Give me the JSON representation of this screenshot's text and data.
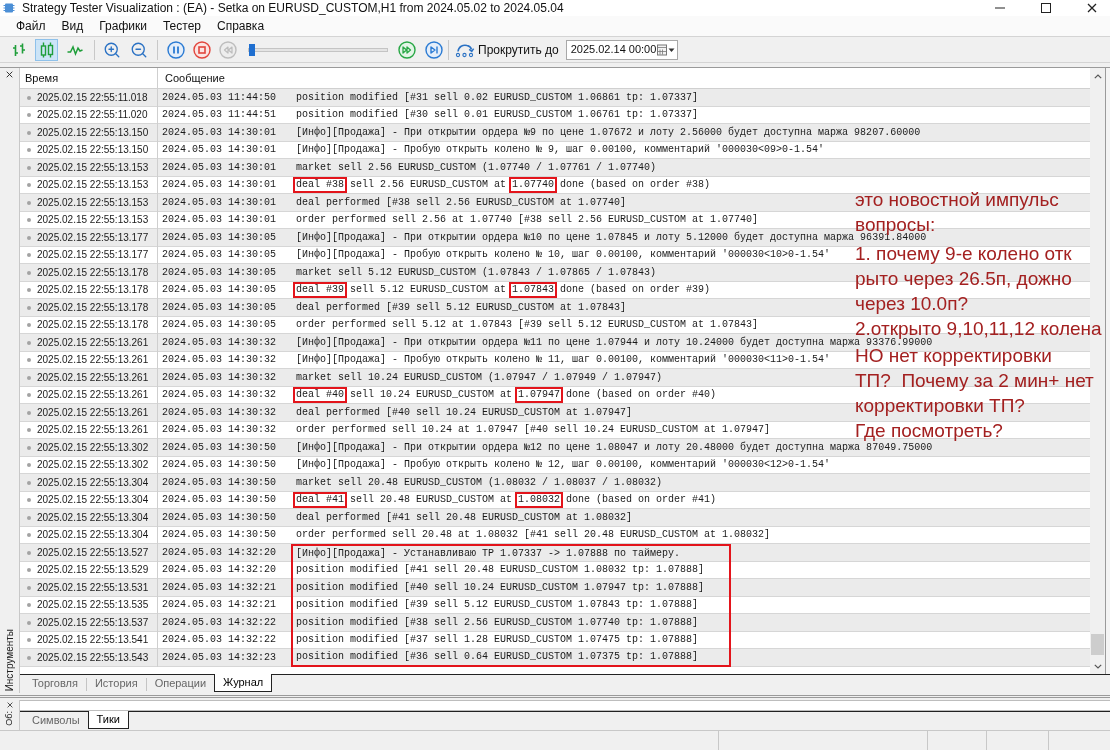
{
  "window": {
    "title": "Strategy Tester Visualization : (EA) - Setka on EURUSD_CUSTOM,H1 from 2024.05.02 to 2024.05.04"
  },
  "menu": [
    "Файл",
    "Вид",
    "Графики",
    "Тестер",
    "Справка"
  ],
  "toolbar": {
    "chart_modes": [
      {
        "kind": "bars",
        "selected": false
      },
      {
        "kind": "candles",
        "selected": true
      },
      {
        "kind": "line",
        "selected": false
      }
    ],
    "zoom": [
      {
        "kind": "zoom_in"
      },
      {
        "kind": "zoom_out"
      }
    ],
    "playback": [
      {
        "kind": "pause",
        "disabled": false
      },
      {
        "kind": "stop",
        "disabled": false
      },
      {
        "kind": "rewind",
        "disabled": true
      }
    ],
    "speed": {
      "level": 0.0
    },
    "stepping": [
      {
        "kind": "fast_forward"
      },
      {
        "kind": "step"
      }
    ],
    "scroll_to": {
      "label": "Прокрутить до",
      "value": "2025.02.14 00:00"
    }
  },
  "journal": {
    "columns": [
      "Время",
      "Сообщение"
    ],
    "rows": [
      {
        "time": "2025.02.15 22:55:11.018",
        "date": "2024.05.03 11:44:50",
        "message": "position modified [#31 sell 0.02 EURUSD_CUSTOM 1.06861 tp: 1.07337]",
        "framed": false
      },
      {
        "time": "2025.02.15 22:55:11.020",
        "date": "2024.05.03 11:44:51",
        "message": "position modified [#30 sell 0.01 EURUSD_CUSTOM 1.06761 tp: 1.07337]",
        "framed": false
      },
      {
        "time": "2025.02.15 22:55:13.150",
        "date": "2024.05.03 14:30:01",
        "message": "[Инфо][Продажа] - При открытии ордера №9 по цене 1.07672 и лоту 2.56000 будет доступна маржа 98207.60000",
        "framed": false
      },
      {
        "time": "2025.02.15 22:55:13.150",
        "date": "2024.05.03 14:30:01",
        "message": "[Инфо][Продажа] - Пробую открыть колено № 9, шаг 0.00100, комментарий '000030<09>0-1.54'",
        "framed": false
      },
      {
        "time": "2025.02.15 22:55:13.153",
        "date": "2024.05.03 14:30:01",
        "message": "market sell 2.56 EURUSD_CUSTOM (1.07740 / 1.07761 / 1.07740)",
        "framed": false
      },
      {
        "time": "2025.02.15 22:55:13.153",
        "date": "2024.05.03 14:30:01",
        "parts": [
          {
            "text": "deal #38",
            "marked": true
          },
          {
            "text": " sell 2.56 EURUSD_CUSTOM at ",
            "marked": false
          },
          {
            "text": "1.07740",
            "marked": true
          },
          {
            "text": " done (based on order #38)",
            "marked": false
          }
        ],
        "framed": false
      },
      {
        "time": "2025.02.15 22:55:13.153",
        "date": "2024.05.03 14:30:01",
        "message": "deal performed [#38 sell 2.56 EURUSD_CUSTOM at 1.07740]",
        "framed": false
      },
      {
        "time": "2025.02.15 22:55:13.153",
        "date": "2024.05.03 14:30:01",
        "message": "order performed sell 2.56 at 1.07740 [#38 sell 2.56 EURUSD_CUSTOM at 1.07740]",
        "framed": false
      },
      {
        "time": "2025.02.15 22:55:13.177",
        "date": "2024.05.03 14:30:05",
        "message": "[Инфо][Продажа] - При открытии ордера №10 по цене 1.07845 и лоту 5.12000 будет доступна маржа 96391.84000",
        "framed": false
      },
      {
        "time": "2025.02.15 22:55:13.177",
        "date": "2024.05.03 14:30:05",
        "message": "[Инфо][Продажа] - Пробую открыть колено № 10, шаг 0.00100, комментарий '000030<10>0-1.54'",
        "framed": false
      },
      {
        "time": "2025.02.15 22:55:13.178",
        "date": "2024.05.03 14:30:05",
        "message": "market sell 5.12 EURUSD_CUSTOM (1.07843 / 1.07865 / 1.07843)",
        "framed": false
      },
      {
        "time": "2025.02.15 22:55:13.178",
        "date": "2024.05.03 14:30:05",
        "parts": [
          {
            "text": "deal #39",
            "marked": true
          },
          {
            "text": " sell 5.12 EURUSD_CUSTOM at ",
            "marked": false
          },
          {
            "text": "1.07843",
            "marked": true
          },
          {
            "text": " done (based on order #39)",
            "marked": false
          }
        ],
        "framed": false
      },
      {
        "time": "2025.02.15 22:55:13.178",
        "date": "2024.05.03 14:30:05",
        "message": "deal performed [#39 sell 5.12 EURUSD_CUSTOM at 1.07843]",
        "framed": false
      },
      {
        "time": "2025.02.15 22:55:13.178",
        "date": "2024.05.03 14:30:05",
        "message": "order performed sell 5.12 at 1.07843 [#39 sell 5.12 EURUSD_CUSTOM at 1.07843]",
        "framed": false
      },
      {
        "time": "2025.02.15 22:55:13.261",
        "date": "2024.05.03 14:30:32",
        "message": "[Инфо][Продажа] - При открытии ордера №11 по цене 1.07944 и лоту 10.24000 будет доступна маржа 93376.99000",
        "framed": false
      },
      {
        "time": "2025.02.15 22:55:13.261",
        "date": "2024.05.03 14:30:32",
        "message": "[Инфо][Продажа] - Пробую открыть колено № 11, шаг 0.00100, комментарий '000030<11>0-1.54'",
        "framed": false
      },
      {
        "time": "2025.02.15 22:55:13.261",
        "date": "2024.05.03 14:30:32",
        "message": "market sell 10.24 EURUSD_CUSTOM (1.07947 / 1.07949 / 1.07947)",
        "framed": false
      },
      {
        "time": "2025.02.15 22:55:13.261",
        "date": "2024.05.03 14:30:32",
        "parts": [
          {
            "text": "deal #40",
            "marked": true
          },
          {
            "text": " sell 10.24 EURUSD_CUSTOM at ",
            "marked": false
          },
          {
            "text": "1.07947",
            "marked": true
          },
          {
            "text": " done (based on order #40)",
            "marked": false
          }
        ],
        "framed": false
      },
      {
        "time": "2025.02.15 22:55:13.261",
        "date": "2024.05.03 14:30:32",
        "message": "deal performed [#40 sell 10.24 EURUSD_CUSTOM at 1.07947]",
        "framed": false
      },
      {
        "time": "2025.02.15 22:55:13.261",
        "date": "2024.05.03 14:30:32",
        "message": "order performed sell 10.24 at 1.07947 [#40 sell 10.24 EURUSD_CUSTOM at 1.07947]",
        "framed": false
      },
      {
        "time": "2025.02.15 22:55:13.302",
        "date": "2024.05.03 14:30:50",
        "message": "[Инфо][Продажа] - При открытии ордера №12 по цене 1.08047 и лоту 20.48000 будет доступна маржа 87049.75000",
        "framed": false
      },
      {
        "time": "2025.02.15 22:55:13.302",
        "date": "2024.05.03 14:30:50",
        "message": "[Инфо][Продажа] - Пробую открыть колено № 12, шаг 0.00100, комментарий '000030<12>0-1.54'",
        "framed": false
      },
      {
        "time": "2025.02.15 22:55:13.304",
        "date": "2024.05.03 14:30:50",
        "message": "market sell 20.48 EURUSD_CUSTOM (1.08032 / 1.08037 / 1.08032)",
        "framed": false
      },
      {
        "time": "2025.02.15 22:55:13.304",
        "date": "2024.05.03 14:30:50",
        "parts": [
          {
            "text": "deal #41",
            "marked": true
          },
          {
            "text": " sell 20.48 EURUSD_CUSTOM at ",
            "marked": false
          },
          {
            "text": "1.08032",
            "marked": true
          },
          {
            "text": " done (based on order #41)",
            "marked": false
          }
        ],
        "framed": false
      },
      {
        "time": "2025.02.15 22:55:13.304",
        "date": "2024.05.03 14:30:50",
        "message": "deal performed [#41 sell 20.48 EURUSD_CUSTOM at 1.08032]",
        "framed": false
      },
      {
        "time": "2025.02.15 22:55:13.304",
        "date": "2024.05.03 14:30:50",
        "message": "order performed sell 20.48 at 1.08032 [#41 sell 20.48 EURUSD_CUSTOM at 1.08032]",
        "framed": false
      },
      {
        "time": "2025.02.15 22:55:13.527",
        "date": "2024.05.03 14:32:20",
        "message": "[Инфо][Продажа] - Устанавливаю TP 1.07337 -> 1.07888 по таймеру.",
        "framed": true
      },
      {
        "time": "2025.02.15 22:55:13.529",
        "date": "2024.05.03 14:32:20",
        "message": "position modified [#41 sell 20.48 EURUSD_CUSTOM 1.08032 tp: 1.07888]",
        "framed": true
      },
      {
        "time": "2025.02.15 22:55:13.531",
        "date": "2024.05.03 14:32:21",
        "message": "position modified [#40 sell 10.24 EURUSD_CUSTOM 1.07947 tp: 1.07888]",
        "framed": true
      },
      {
        "time": "2025.02.15 22:55:13.535",
        "date": "2024.05.03 14:32:21",
        "message": "position modified [#39 sell 5.12 EURUSD_CUSTOM 1.07843 tp: 1.07888]",
        "framed": true
      },
      {
        "time": "2025.02.15 22:55:13.537",
        "date": "2024.05.03 14:32:22",
        "message": "position modified [#38 sell 2.56 EURUSD_CUSTOM 1.07740 tp: 1.07888]",
        "framed": true
      },
      {
        "time": "2025.02.15 22:55:13.541",
        "date": "2024.05.03 14:32:22",
        "message": "position modified [#37 sell 1.28 EURUSD_CUSTOM 1.07475 tp: 1.07888]",
        "framed": true
      },
      {
        "time": "2025.02.15 22:55:13.543",
        "date": "2024.05.03 14:32:23",
        "message": "position modified [#36 sell 0.64 EURUSD_CUSTOM 1.07375 tp: 1.07888]",
        "framed": true
      }
    ]
  },
  "annotation": {
    "lines": [
      "это новостной импульс",
      "вопросы:",
      "1. почему 9-е колено отк",
      "рыто через 26.5п, дожно",
      "через 10.0п?",
      "2.открыто 9,10,11,12 колена",
      "НО нет корректировки",
      "ТП?  Почему за 2 мин+ нет",
      "корректировки ТП?",
      "Где посмотреть?"
    ]
  },
  "tools_panel": {
    "side_label": "Инструменты",
    "tabs": [
      {
        "label": "Торговля",
        "selected": false
      },
      {
        "label": "История",
        "selected": false
      },
      {
        "label": "Операции",
        "selected": false
      },
      {
        "label": "Журнал",
        "selected": true
      }
    ]
  },
  "bottom_panel": {
    "side_label": "Об:",
    "tabs": [
      {
        "label": "Символы",
        "selected": false
      },
      {
        "label": "Тики",
        "selected": true
      }
    ]
  }
}
